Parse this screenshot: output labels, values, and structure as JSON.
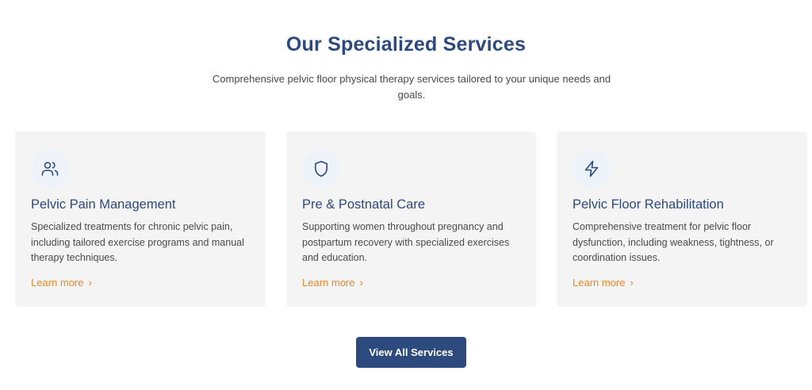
{
  "header": {
    "title": "Our Specialized Services",
    "subtitle": "Comprehensive pelvic floor physical therapy services tailored to your unique needs and goals."
  },
  "colors": {
    "heading": "#2c4a7d",
    "accent": "#e8862a",
    "card_bg": "#f4f4f4",
    "button_bg": "#2c4a7d"
  },
  "services": [
    {
      "icon": "users-icon",
      "title": "Pelvic Pain Management",
      "description": "Specialized treatments for chronic pelvic pain, including tailored exercise programs and manual therapy techniques.",
      "link_label": "Learn more"
    },
    {
      "icon": "shield-icon",
      "title": "Pre & Postnatal Care",
      "description": "Supporting women throughout pregnancy and postpartum recovery with specialized exercises and education.",
      "link_label": "Learn more"
    },
    {
      "icon": "lightning-icon",
      "title": "Pelvic Floor Rehabilitation",
      "description": "Comprehensive treatment for pelvic floor dysfunction, including weakness, tightness, or coordination issues.",
      "link_label": "Learn more"
    }
  ],
  "cta": {
    "label": "View All Services"
  }
}
